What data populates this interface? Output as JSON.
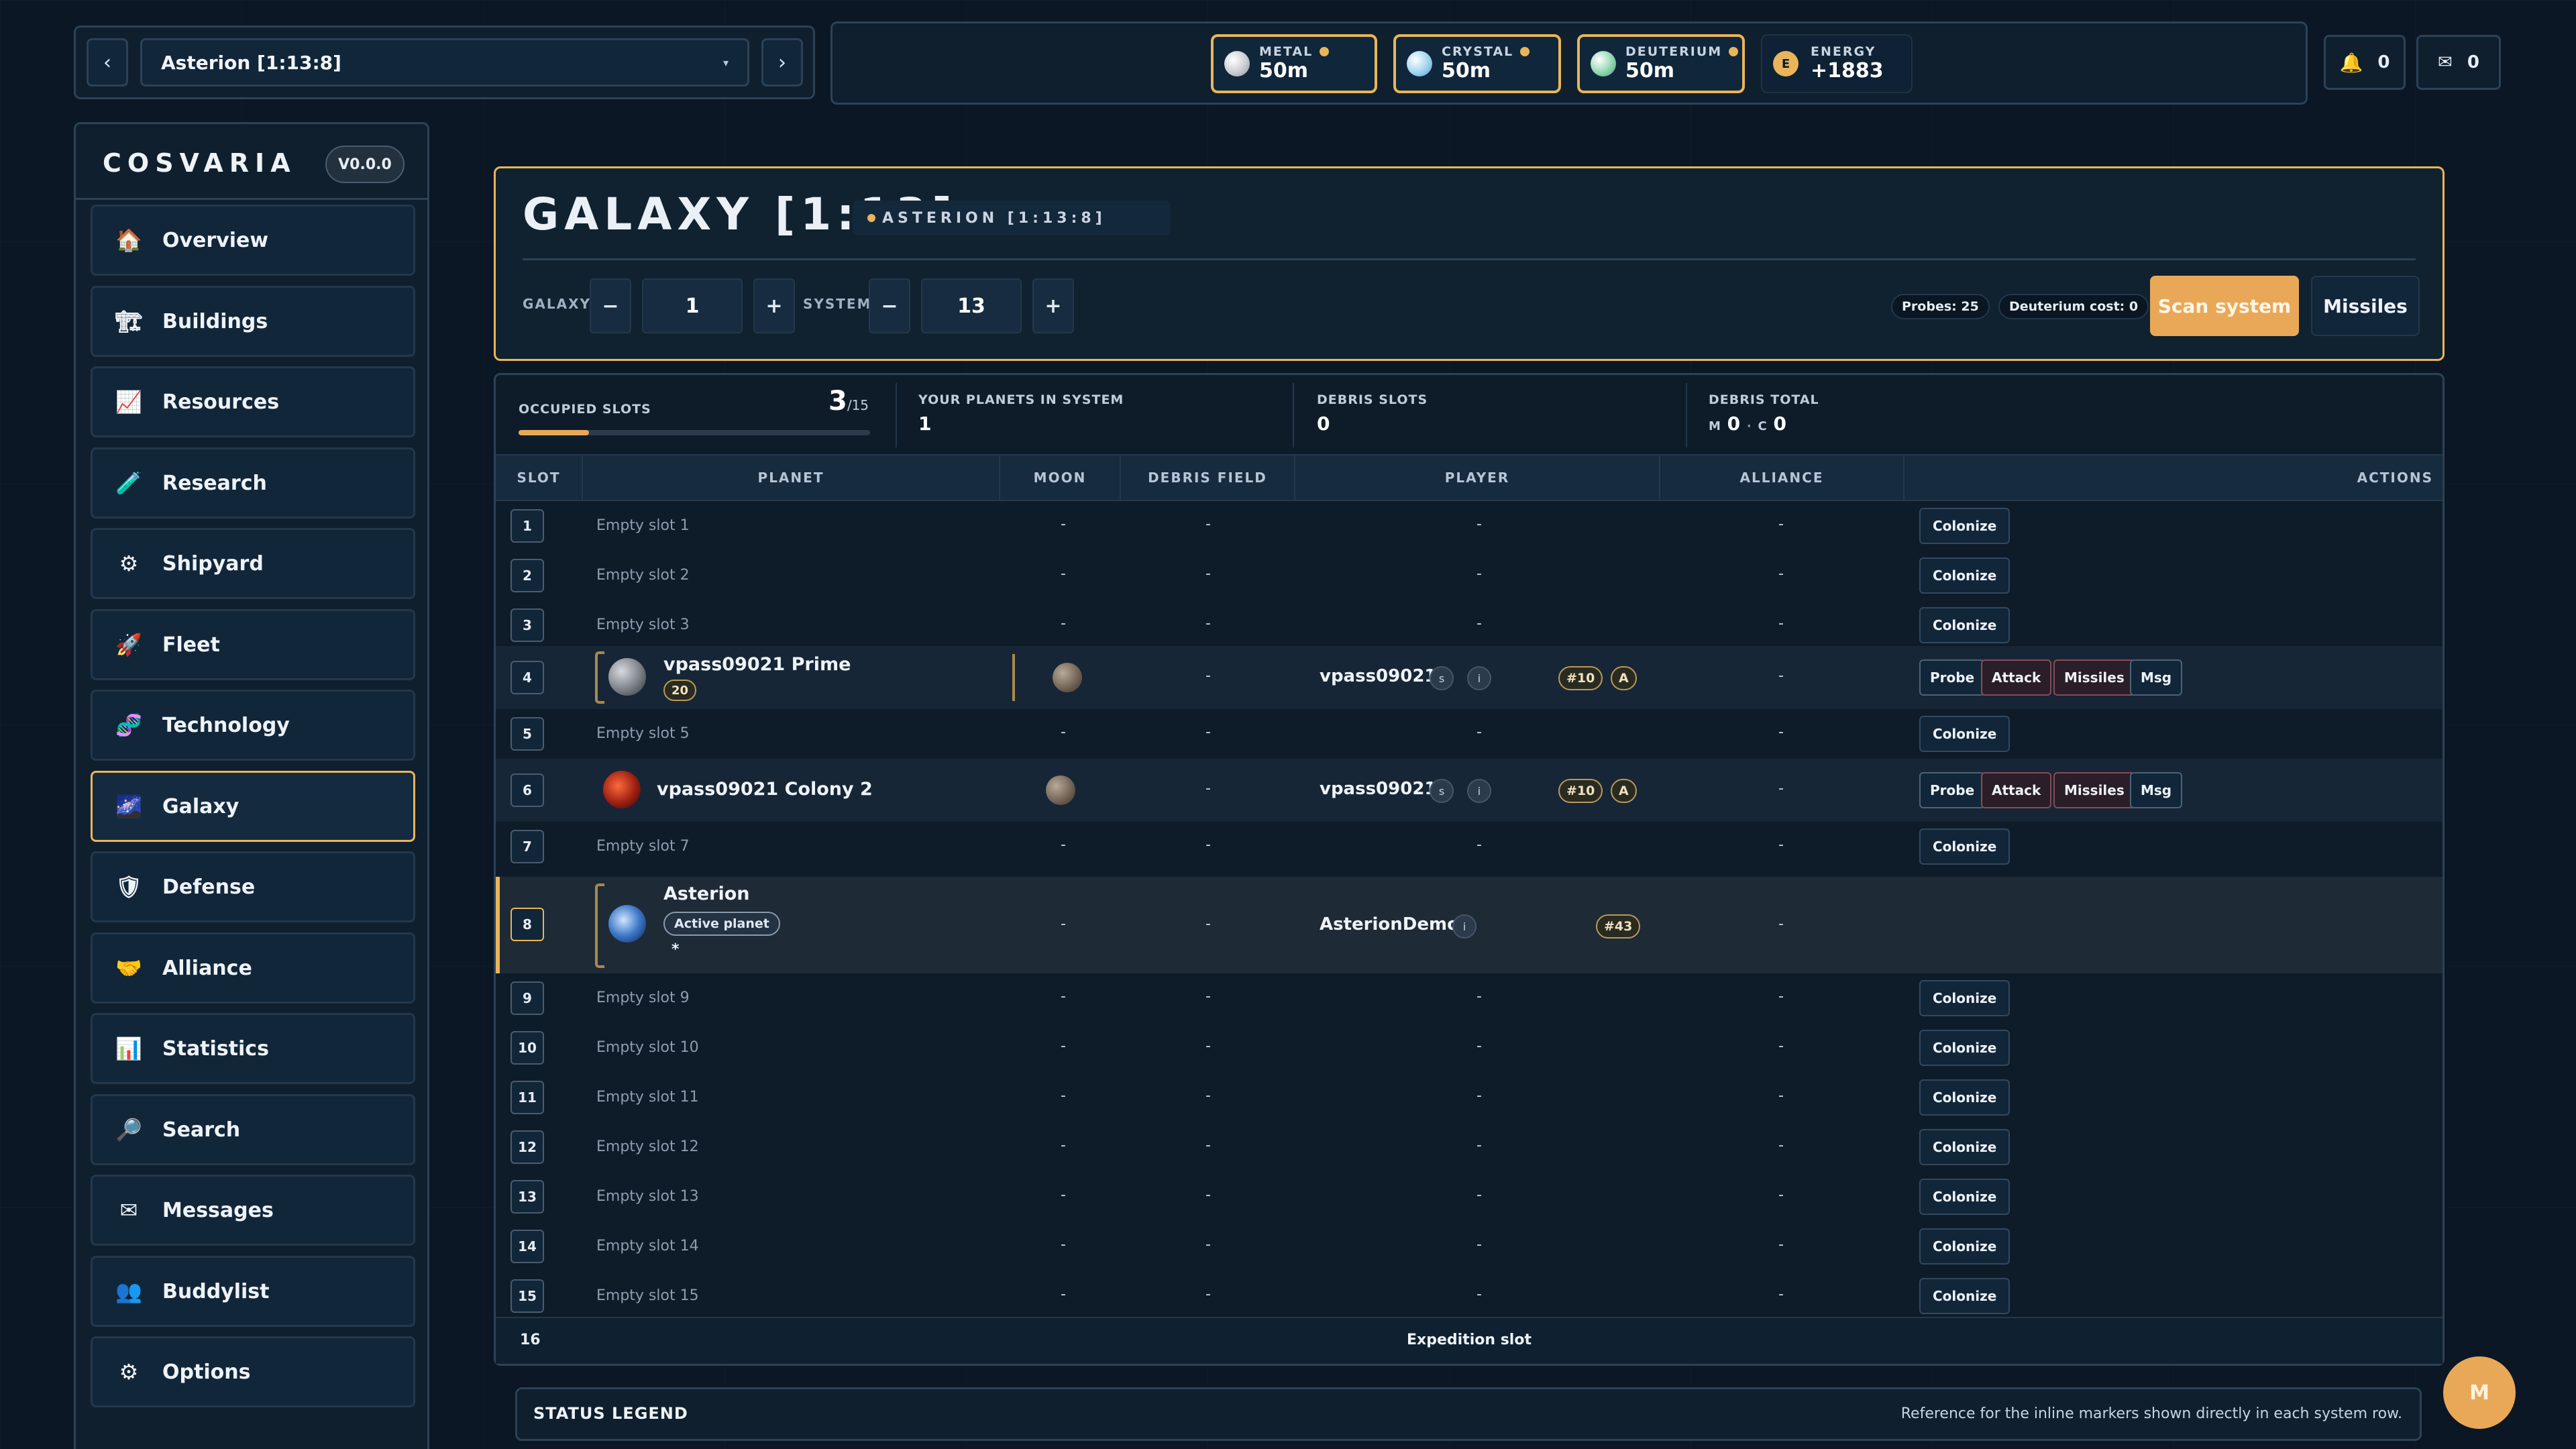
{
  "planet_selector": {
    "prev": "‹",
    "next": "›",
    "current": "Asterion [1:13:8]",
    "chevron": "▾"
  },
  "resources": [
    {
      "label": "METAL",
      "value": "50m",
      "color": "#c9ccd2"
    },
    {
      "label": "CRYSTAL",
      "value": "50m",
      "color": "#9fd4f0"
    },
    {
      "label": "DEUTERIUM",
      "value": "50m",
      "color": "#8fd6b0"
    }
  ],
  "energy": {
    "label": "ENERGY",
    "value": "+1883",
    "badge": "E"
  },
  "notifications": {
    "alerts": "0",
    "mail": "0",
    "alerts_icon": "bell-icon",
    "mail_icon": "mail-icon"
  },
  "sidebar": {
    "brand": "COSVARIA",
    "version": "V0.0.0",
    "items": [
      {
        "label": "Overview",
        "icon": "🏠"
      },
      {
        "label": "Buildings",
        "icon": "🏗"
      },
      {
        "label": "Resources",
        "icon": "📈"
      },
      {
        "label": "Research",
        "icon": "🧪"
      },
      {
        "label": "Shipyard",
        "icon": "⚙"
      },
      {
        "label": "Fleet",
        "icon": "🚀"
      },
      {
        "label": "Technology",
        "icon": "🧬"
      },
      {
        "label": "Galaxy",
        "icon": "🌌"
      },
      {
        "label": "Defense",
        "icon": "🛡"
      },
      {
        "label": "Alliance",
        "icon": "🤝"
      },
      {
        "label": "Statistics",
        "icon": "📊"
      },
      {
        "label": "Search",
        "icon": "🔎"
      },
      {
        "label": "Messages",
        "icon": "✉"
      },
      {
        "label": "Buddylist",
        "icon": "👥"
      },
      {
        "label": "Options",
        "icon": "⚙"
      }
    ]
  },
  "galaxy": {
    "title": "GALAXY [1:13]",
    "subtitle": "ASTERION [1:13:8]",
    "galaxy_label": "GALAXY",
    "galaxy_value": "1",
    "system_label": "SYSTEM",
    "system_value": "13",
    "minus": "−",
    "plus": "+",
    "probes": "Probes: 25",
    "deut_cost": "Deuterium cost: 0",
    "scan_label": "Scan system",
    "missiles_label": "Missiles"
  },
  "stats": {
    "occupied_label": "OCCUPIED SLOTS",
    "occupied_value": "3",
    "occupied_total": "/15",
    "occupied_fraction": 0.2,
    "your_planets_label": "YOUR PLANETS IN SYSTEM",
    "your_planets_value": "1",
    "debris_slots_label": "DEBRIS SLOTS",
    "debris_slots_value": "0",
    "debris_total_label": "DEBRIS TOTAL",
    "debris_m_label": "M",
    "debris_m_value": "0",
    "debris_sep": "·",
    "debris_c_label": "C",
    "debris_c_value": "0"
  },
  "table": {
    "headers": [
      "SLOT",
      "PLANET",
      "MOON",
      "DEBRIS FIELD",
      "PLAYER",
      "ALLIANCE",
      "ACTIONS"
    ],
    "dash": "-",
    "colonize": "Colonize",
    "empty_rows": [
      {
        "slot": "1",
        "label": "Empty slot 1"
      },
      {
        "slot": "2",
        "label": "Empty slot 2"
      },
      {
        "slot": "3",
        "label": "Empty slot 3"
      },
      {
        "slot": "5",
        "label": "Empty slot 5"
      },
      {
        "slot": "7",
        "label": "Empty slot 7"
      },
      {
        "slot": "9",
        "label": "Empty slot 9"
      },
      {
        "slot": "10",
        "label": "Empty slot 10"
      },
      {
        "slot": "11",
        "label": "Empty slot 11"
      },
      {
        "slot": "12",
        "label": "Empty slot 12"
      },
      {
        "slot": "13",
        "label": "Empty slot 13"
      },
      {
        "slot": "14",
        "label": "Empty slot 14"
      },
      {
        "slot": "15",
        "label": "Empty slot 15"
      }
    ],
    "row4": {
      "slot": "4",
      "planet": "vpass09021 Prime",
      "level": "20",
      "player": "vpass09021",
      "s": "s",
      "i": "i",
      "rank": "#10",
      "tag": "A"
    },
    "row6": {
      "slot": "6",
      "planet": "vpass09021 Colony 2",
      "player": "vpass09021",
      "s": "s",
      "i": "i",
      "rank": "#10",
      "tag": "A"
    },
    "row8": {
      "slot": "8",
      "planet": "Asterion",
      "active": "Active planet",
      "star": "*",
      "player": "AsterionDemo",
      "i": "i",
      "rank": "#43"
    },
    "actions": {
      "probe": "Probe",
      "attack": "Attack",
      "missiles": "Missiles",
      "msg": "Msg"
    },
    "expedition": {
      "slot": "16",
      "label": "Expedition slot"
    }
  },
  "legend": {
    "title": "STATUS LEGEND",
    "desc": "Reference for the inline markers shown directly in each system row."
  },
  "avatar": "M"
}
